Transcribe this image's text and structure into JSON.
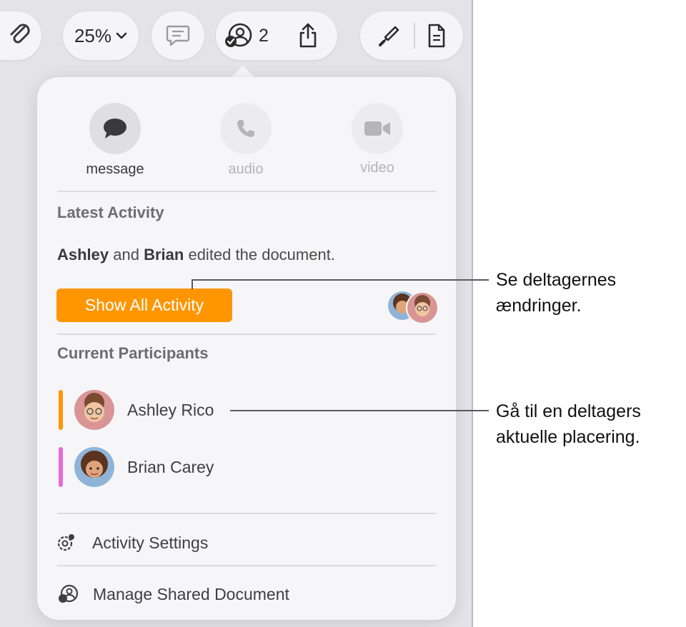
{
  "toolbar": {
    "zoom_value": "25%",
    "collaborator_count": "2"
  },
  "popover": {
    "actions": [
      {
        "label": "message",
        "icon": "message-bubble-icon",
        "enabled": true
      },
      {
        "label": "audio",
        "icon": "phone-icon",
        "enabled": false
      },
      {
        "label": "video",
        "icon": "video-camera-icon",
        "enabled": false
      }
    ],
    "latest_activity": {
      "title": "Latest Activity",
      "name1": "Ashley",
      "joiner": " and ",
      "name2": "Brian",
      "suffix": " edited the document.",
      "button_label": "Show All Activity"
    },
    "participants": {
      "title": "Current Participants",
      "items": [
        {
          "name": "Ashley Rico",
          "color": "#ff9500"
        },
        {
          "name": "Brian Carey",
          "color": "#e66ad9"
        }
      ]
    },
    "menu": {
      "activity_settings": "Activity Settings",
      "manage_shared": "Manage Shared Document"
    }
  },
  "callouts": {
    "activity_line1": "Se deltagernes",
    "activity_line2": "ændringer.",
    "participant_line1": "Gå til en deltagers",
    "participant_line2": "aktuelle placering."
  },
  "colors": {
    "accent_orange": "#ff9500",
    "participant_pink": "#e66ad9"
  }
}
